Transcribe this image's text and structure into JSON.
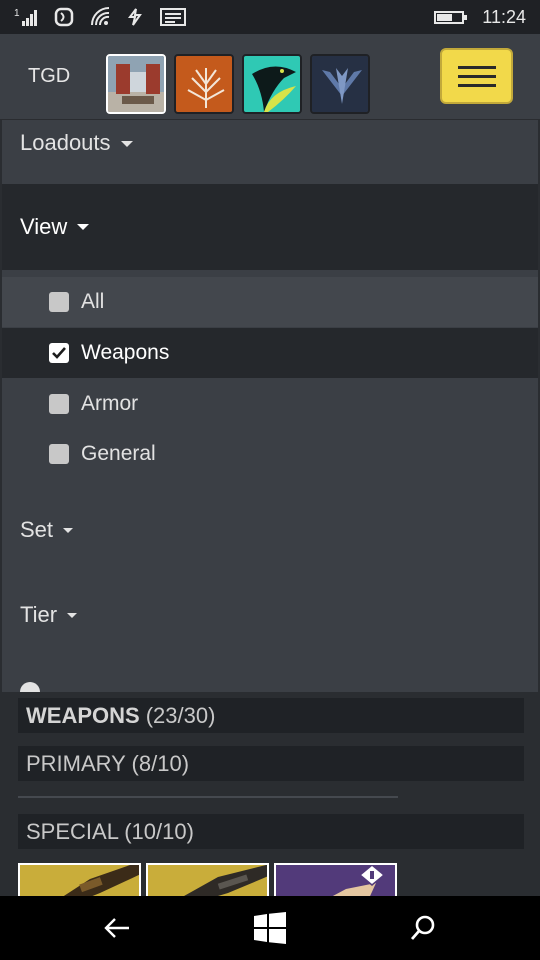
{
  "status": {
    "time": "11:24",
    "battery_level": 0.55,
    "icons": [
      "signal-icon",
      "nfc-icon",
      "wifi-icon",
      "data-sync-icon",
      "message-icon",
      "battery-icon"
    ]
  },
  "header": {
    "character_name": "TGD",
    "emblems": [
      {
        "name": "emblem-room",
        "active": true,
        "color": "#7a8ea0"
      },
      {
        "name": "emblem-tree",
        "active": false,
        "color": "#c0561c"
      },
      {
        "name": "emblem-raven",
        "active": false,
        "color": "#2fc9b4"
      },
      {
        "name": "emblem-hunter",
        "active": false,
        "color": "#262d3d"
      }
    ],
    "menu_color": "#f2d94a"
  },
  "dropdown": {
    "loadouts_label": "Loadouts",
    "view_label": "View",
    "filters": [
      {
        "label": "All",
        "checked": false
      },
      {
        "label": "Weapons",
        "checked": true
      },
      {
        "label": "Armor",
        "checked": false
      },
      {
        "label": "General",
        "checked": false
      }
    ],
    "set_label": "Set",
    "tier_label": "Tier"
  },
  "inventory": {
    "weapons_title": "WEAPONS",
    "weapons_count": "(23/30)",
    "primary_label": "PRIMARY (8/10)",
    "special_label": "SPECIAL (10/10)"
  },
  "nav": {
    "icons": [
      "back-arrow-icon",
      "windows-icon",
      "search-icon"
    ]
  }
}
